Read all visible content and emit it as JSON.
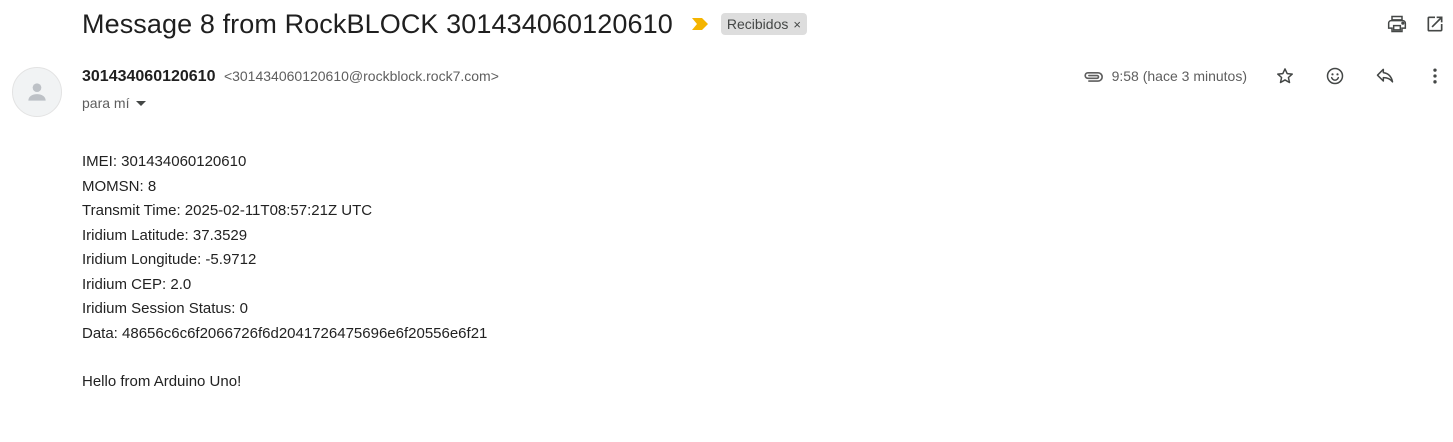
{
  "header": {
    "subject": "Message 8 from RockBLOCK 301434060120610",
    "label": "Recibidos",
    "label_remove": "×"
  },
  "sender": {
    "name": "301434060120610",
    "email": "<301434060120610@rockblock.rock7.com>",
    "to": "para mí",
    "time": "9:58 (hace 3 minutos)"
  },
  "body": {
    "lines": [
      "IMEI: 301434060120610",
      "MOMSN: 8",
      "Transmit Time: 2025-02-11T08:57:21Z UTC",
      "Iridium Latitude: 37.3529",
      "Iridium Longitude: -5.9712",
      "Iridium CEP: 2.0",
      "Iridium Session Status: 0",
      "Data: 48656c6c6f2066726f6d2041726475696e6f20556e6f21"
    ],
    "greeting": "Hello from Arduino Uno!"
  },
  "icons": {
    "importance": "importance-marker-icon",
    "print": "print-icon",
    "open_new_window": "open-in-new-window-icon",
    "avatar": "person-icon",
    "attachment": "attachment-icon",
    "star": "star-icon",
    "emoji": "emoji-icon",
    "reply": "reply-icon",
    "more": "more-vert-icon"
  },
  "colors": {
    "importance": "#f4b400",
    "chip_bg": "#dddddd",
    "secondary_text": "#5e5e5e"
  }
}
